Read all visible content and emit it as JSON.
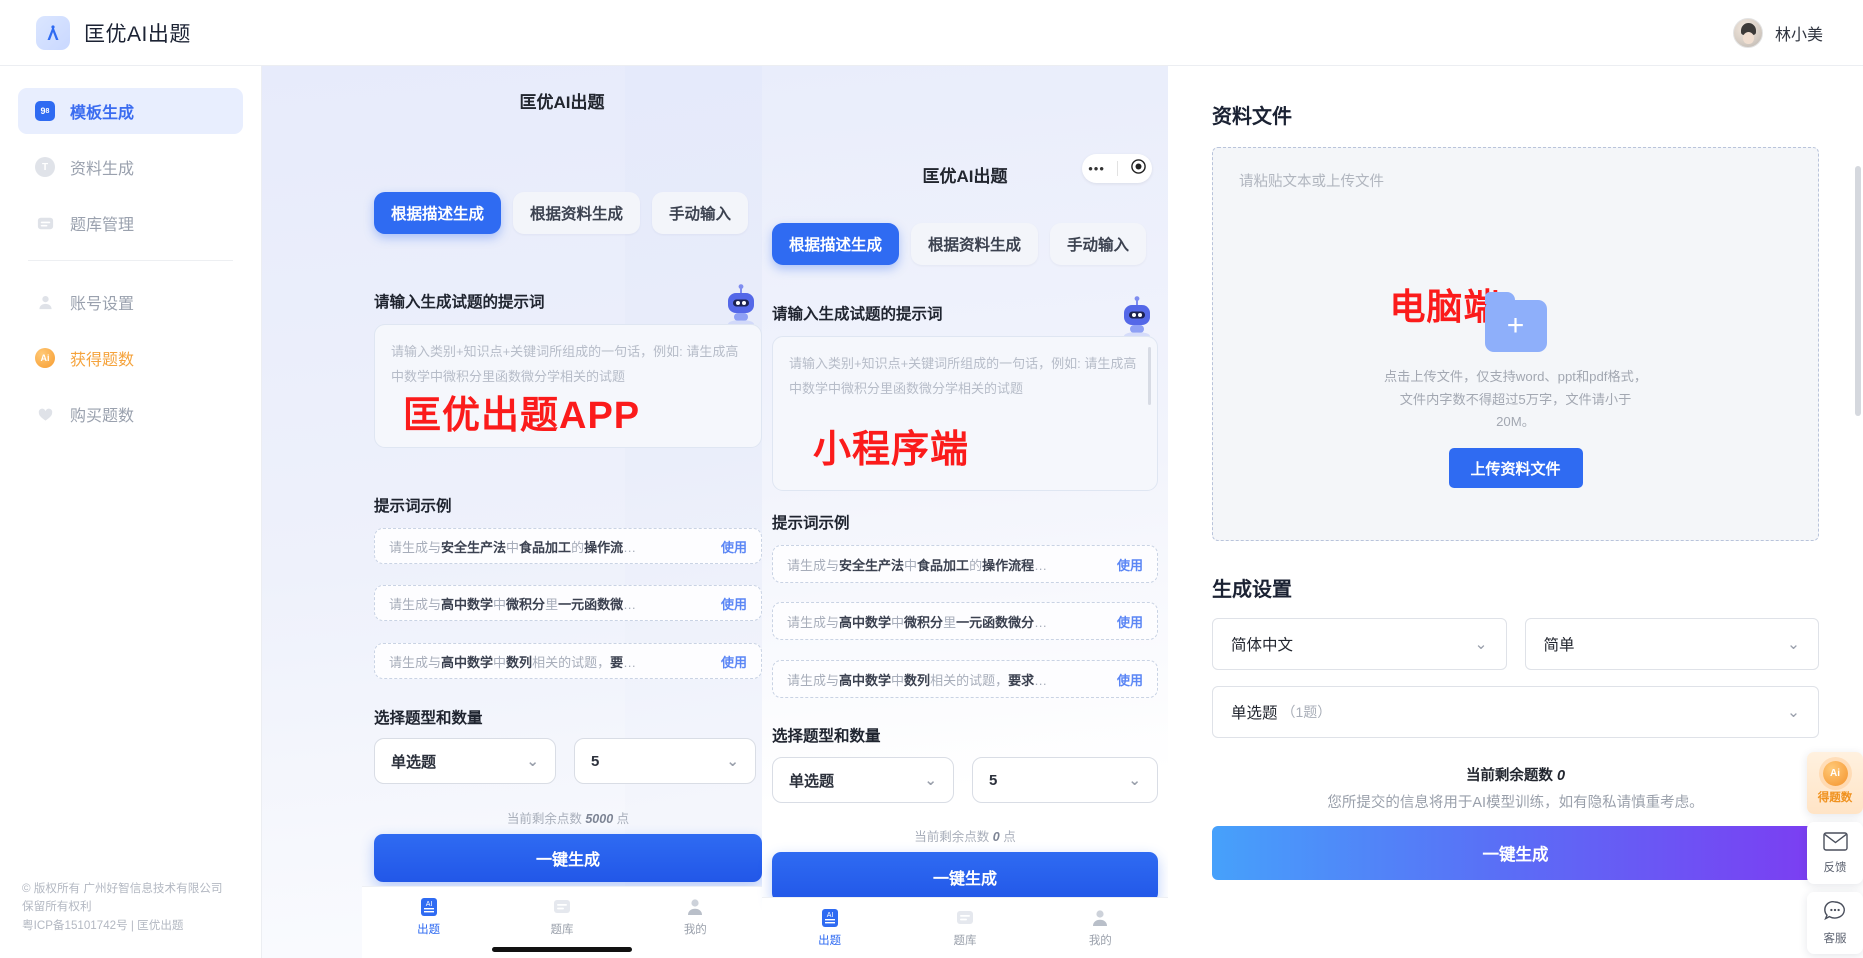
{
  "topbar": {
    "brand_name": "匡优AI出题",
    "logo_icon": "lambda-logo-icon",
    "user_name": "林小美",
    "avatar_icon": "user-avatar"
  },
  "sidebar": {
    "items": [
      {
        "label": "模板生成",
        "icon": "template-icon",
        "active": true,
        "style": "blue"
      },
      {
        "label": "资料生成",
        "icon": "text-circle-icon",
        "active": false,
        "style": "grey"
      },
      {
        "label": "题库管理",
        "icon": "archive-icon",
        "active": false,
        "style": "grey"
      }
    ],
    "items2": [
      {
        "label": "账号设置",
        "icon": "person-icon",
        "active": false,
        "style": "grey"
      },
      {
        "label": "获得题数",
        "icon": "ai-coin-icon",
        "active": false,
        "style": "orange"
      },
      {
        "label": "购买题数",
        "icon": "heart-icon",
        "active": false,
        "style": "grey"
      }
    ],
    "footer": {
      "line1": "© 版权所有 广州好智信息技术有限公司",
      "line2": "保留所有权利",
      "line3": "粤ICP备15101742号 | 匡优出题"
    }
  },
  "app_mock": {
    "watermark": "匡优出题APP",
    "title": "匡优AI出题",
    "tabs": [
      {
        "label": "根据描述生成",
        "active": true
      },
      {
        "label": "根据资料生成",
        "active": false
      },
      {
        "label": "手动输入",
        "active": false
      }
    ],
    "prompt_label": "请输入生成试题的提示词",
    "robot_icon": "robot-avatar-icon",
    "textarea_placeholder": "请输入类别+知识点+关键词所组成的一句话，例如: 请生成高中数学中微积分里函数微分学相关的试题",
    "examples_title": "提示词示例",
    "examples": [
      {
        "prefix": "请生成与",
        "bold1": "安全生产法",
        "mid": "中",
        "bold2": "食品加工",
        "mid2": "的",
        "bold3": "操作流",
        "tail": "…",
        "use": "使用"
      },
      {
        "prefix": "请生成与",
        "bold1": "高中数学",
        "mid": "中",
        "bold2": "微积分",
        "mid2": "里",
        "bold3": "一元函数微",
        "tail": "…",
        "use": "使用"
      },
      {
        "prefix": "请生成与",
        "bold1": "高中数学",
        "mid": "中",
        "bold2": "数列",
        "mid2": "相关的试题，",
        "bold3": "要",
        "tail": "…",
        "use": "使用"
      }
    ],
    "select_title": "选择题型和数量",
    "select_type": "单选题",
    "select_count": "5",
    "points_prefix": "当前剩余点数",
    "points_value": "5000",
    "points_suffix": "点",
    "generate_label": "一键生成",
    "tabbar": [
      {
        "label": "出题",
        "icon": "ai-doc-icon",
        "active": true
      },
      {
        "label": "题库",
        "icon": "archive-icon",
        "active": false
      },
      {
        "label": "我的",
        "icon": "person-icon",
        "active": false
      }
    ]
  },
  "mini_mock": {
    "watermark": "小程序端",
    "title": "匡优AI出题",
    "capsule": {
      "dots_icon": "more-dots-icon",
      "target_icon": "target-circle-icon"
    },
    "tabs": [
      {
        "label": "根据描述生成",
        "active": true
      },
      {
        "label": "根据资料生成",
        "active": false
      },
      {
        "label": "手动输入",
        "active": false
      }
    ],
    "prompt_label": "请输入生成试题的提示词",
    "robot_icon": "robot-avatar-icon",
    "textarea_placeholder": "请输入类别+知识点+关键词所组成的一句话，例如: 请生成高中数学中微积分里函数微分学相关的试题",
    "examples_title": "提示词示例",
    "examples": [
      {
        "prefix": "请生成与",
        "bold1": "安全生产法",
        "mid": "中",
        "bold2": "食品加工",
        "mid2": "的",
        "bold3": "操作流程",
        "tail": "…",
        "use": "使用"
      },
      {
        "prefix": "请生成与",
        "bold1": "高中数学",
        "mid": "中",
        "bold2": "微积分",
        "mid2": "里",
        "bold3": "一元函数微分",
        "tail": "…",
        "use": "使用"
      },
      {
        "prefix": "请生成与",
        "bold1": "高中数学",
        "mid": "中",
        "bold2": "数列",
        "mid2": "相关的试题，",
        "bold3": "要求",
        "tail": "…",
        "use": "使用"
      }
    ],
    "select_title": "选择题型和数量",
    "select_type": "单选题",
    "select_count": "5",
    "points_prefix": "当前剩余点数",
    "points_value": "0",
    "points_suffix": "点",
    "generate_label": "一键生成",
    "tabbar": [
      {
        "label": "出题",
        "icon": "ai-doc-icon",
        "active": true
      },
      {
        "label": "题库",
        "icon": "archive-icon",
        "active": false
      },
      {
        "label": "我的",
        "icon": "person-icon",
        "active": false
      }
    ]
  },
  "right_panel": {
    "watermark": "电脑端",
    "files_title": "资料文件",
    "paste_placeholder": "请粘贴文本或上传文件",
    "folder_icon": "folder-plus-icon",
    "upload_hint": "点击上传文件，仅支持word、ppt和pdf格式，文件内字数不得超过5万字，文件请小于 20M。",
    "upload_button": "上传资料文件",
    "settings_title": "生成设置",
    "language_value": "简体中文",
    "difficulty_value": "简单",
    "qtype_value": "单选题",
    "qtype_count": "（1题）",
    "remaining_prefix": "当前剩余题数",
    "remaining_value": "0",
    "privacy_note": "您所提交的信息将用于AI模型训练，如有隐私请慎重考虑。",
    "generate_label": "一键生成"
  },
  "rail": [
    {
      "label": "得题数",
      "icon": "ai-coin-icon",
      "hot": true
    },
    {
      "label": "反馈",
      "icon": "envelope-icon",
      "hot": false
    },
    {
      "label": "客服",
      "icon": "chat-bubble-icon",
      "hot": false
    }
  ],
  "colors": {
    "accent_blue": "#2f6bf2",
    "accent_orange": "#f4932c",
    "watermark_red": "#fb1b1b",
    "sidebar_active_bg": "#e8eefe"
  }
}
